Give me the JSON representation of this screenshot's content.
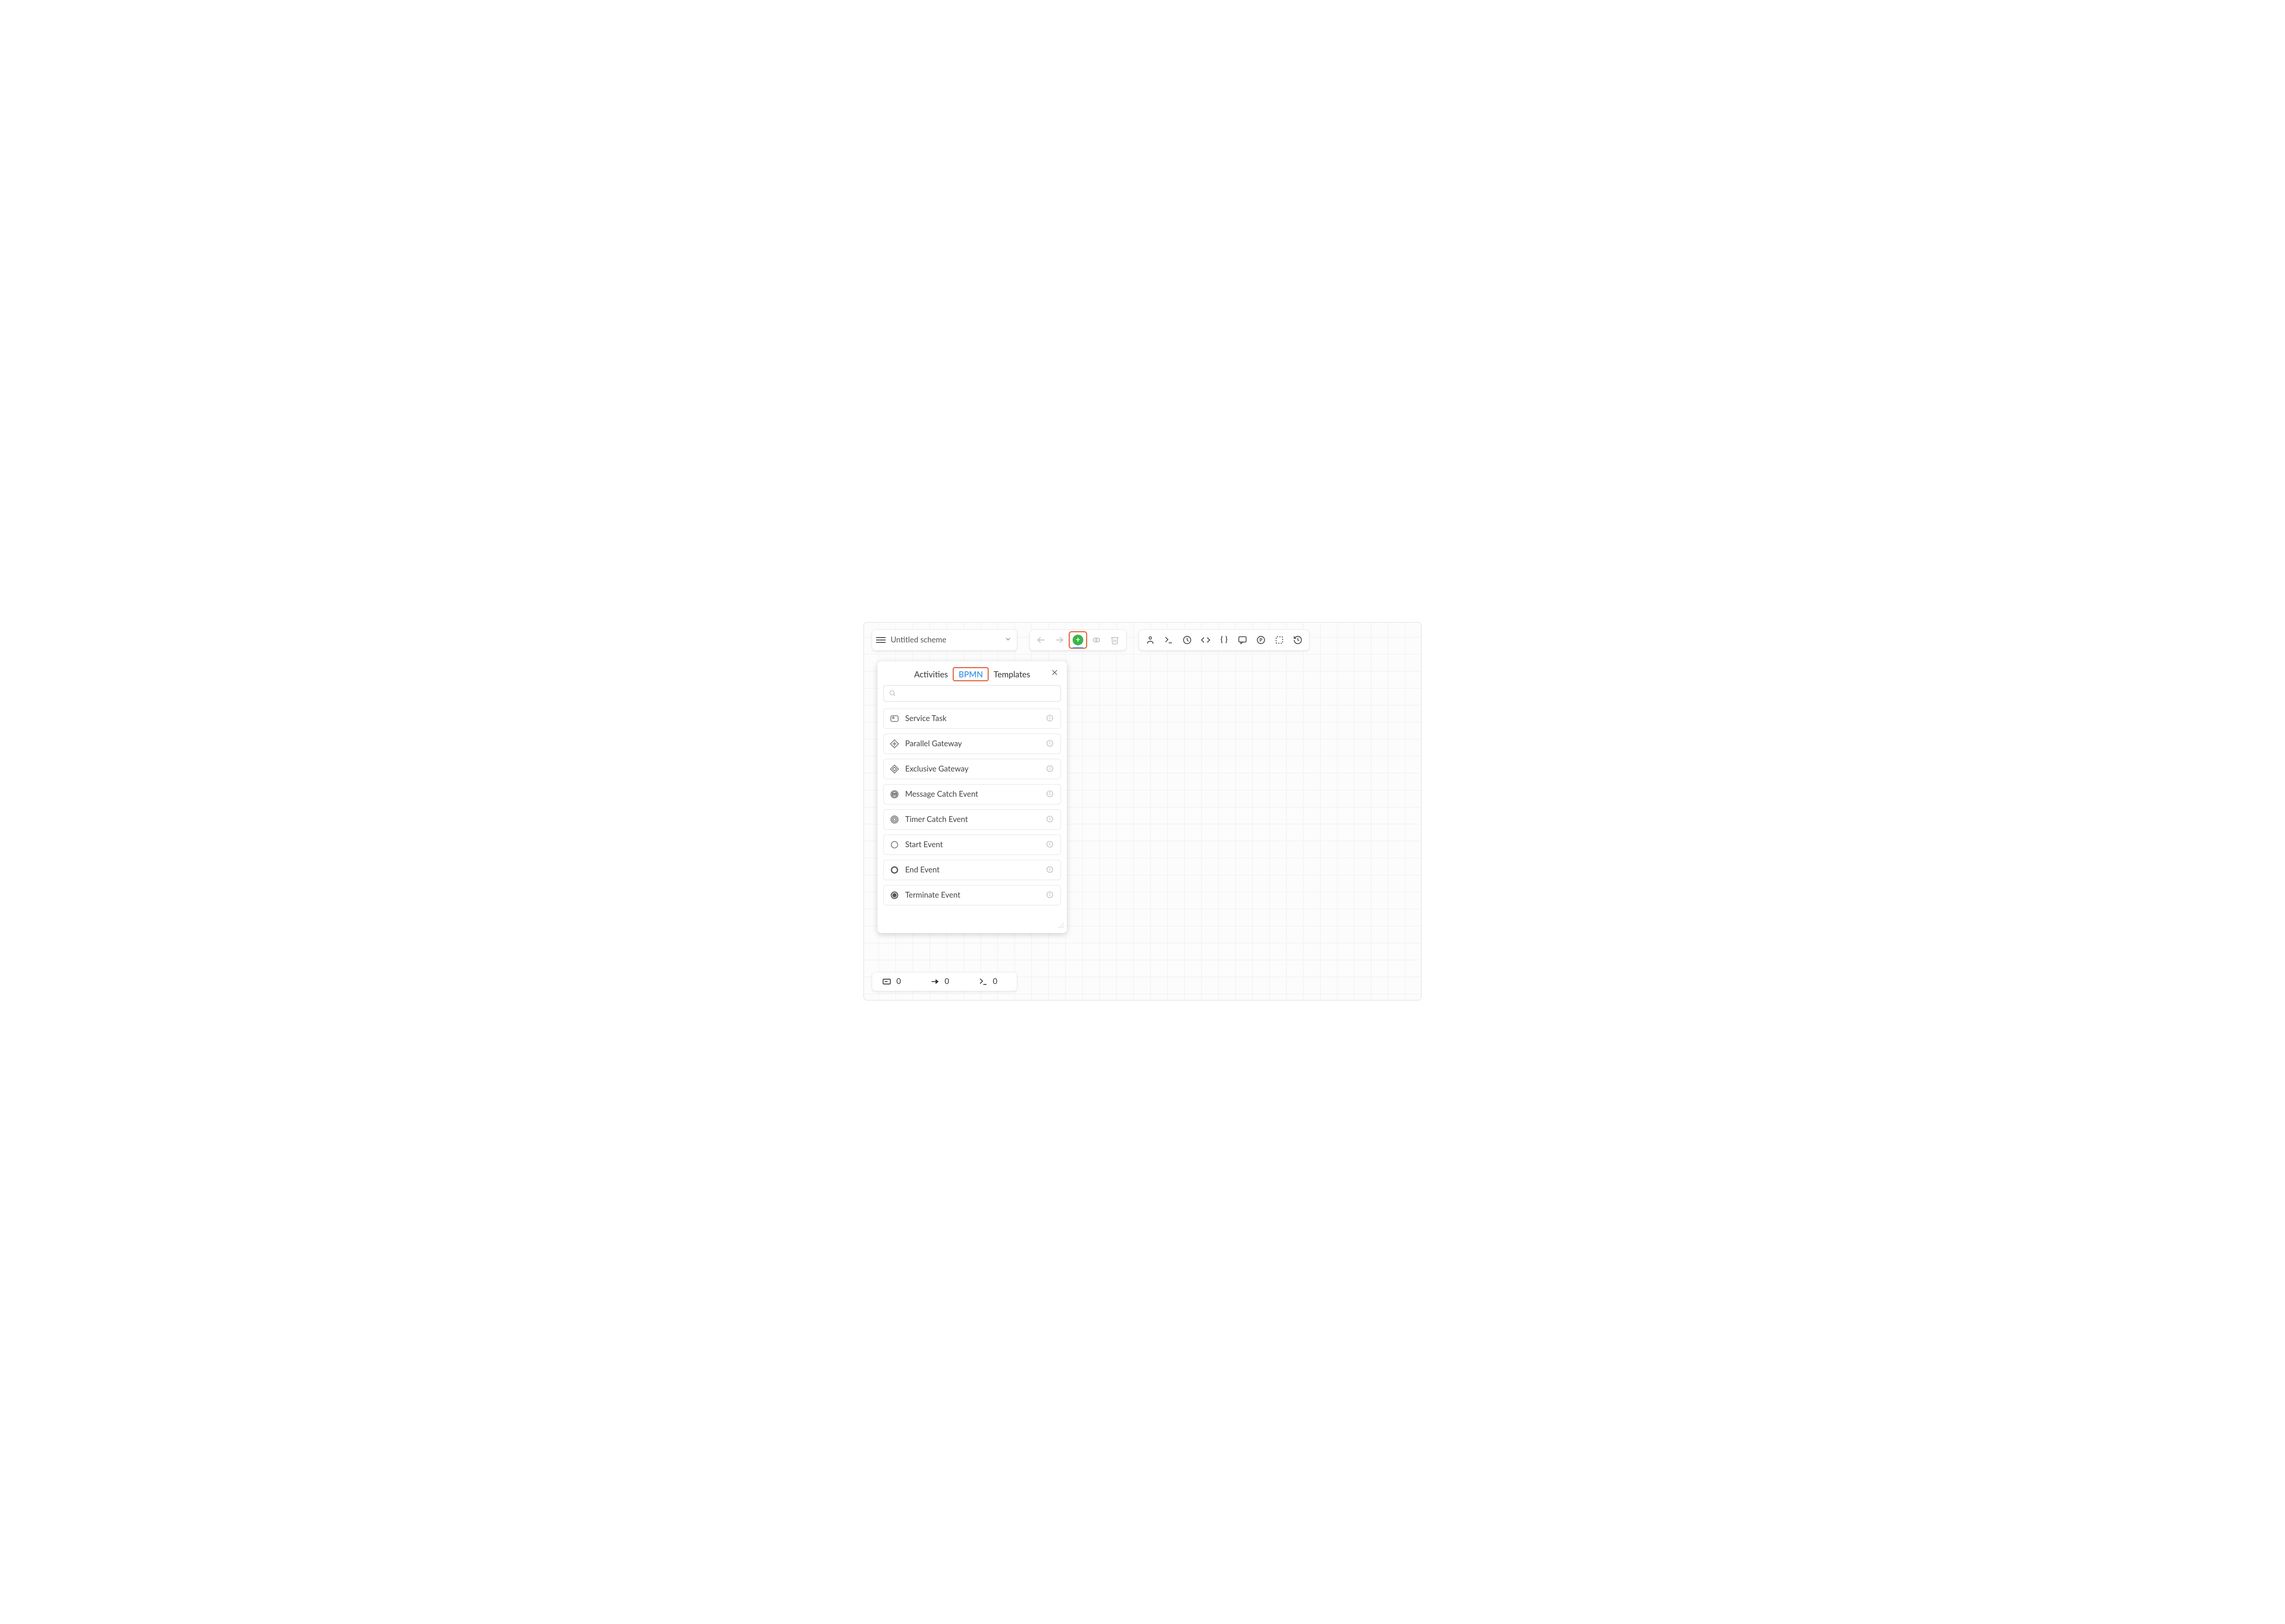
{
  "header": {
    "scheme_title": "Untitled scheme"
  },
  "panel": {
    "tabs": {
      "activities": "Activities",
      "bpmn": "BPMN",
      "templates": "Templates"
    },
    "search_placeholder": "",
    "items": [
      {
        "label": "Service Task"
      },
      {
        "label": "Parallel Gateway"
      },
      {
        "label": "Exclusive Gateway"
      },
      {
        "label": "Message Catch Event"
      },
      {
        "label": "Timer Catch Event"
      },
      {
        "label": "Start Event"
      },
      {
        "label": "End Event"
      },
      {
        "label": "Terminate Event"
      }
    ]
  },
  "status": {
    "activities": "0",
    "transitions": "0",
    "commands": "0"
  },
  "colors": {
    "highlight": "#e05a2b",
    "accent_blue": "#2f8fe6",
    "add_green": "#3ab54a"
  }
}
